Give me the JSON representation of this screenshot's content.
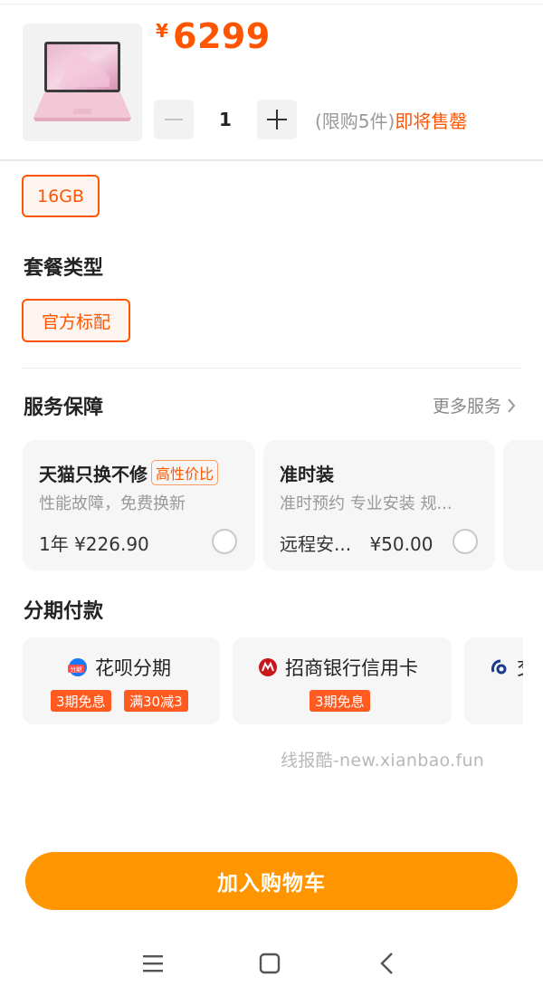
{
  "product": {
    "currency": "¥",
    "price": "6299",
    "quantity": "1",
    "limit_text": "(限购5件)",
    "limit_status": "即将售罄"
  },
  "specs": {
    "memory_option": "16GB",
    "package_title": "套餐类型",
    "package_option": "官方标配"
  },
  "services": {
    "title": "服务保障",
    "more_label": "更多服务",
    "cards": [
      {
        "title": "天猫只换不修",
        "tag": "高性价比",
        "subtitle": "性能故障，免费换新",
        "price_row": "1年 ¥226.90"
      },
      {
        "title": "准时装",
        "subtitle": "准时预约 专业安装 规...",
        "price_label": "远程安...",
        "price": "¥50.00"
      }
    ]
  },
  "installments": {
    "title": "分期付款",
    "options": [
      {
        "name": "花呗分期",
        "tags": [
          "3期免息",
          "满30减3"
        ]
      },
      {
        "name": "招商银行信用卡",
        "tags": [
          "3期免息"
        ]
      },
      {
        "name": "交"
      }
    ]
  },
  "watermark": "线报酷-new.xianbao.fun",
  "cart_button": "加入购物车",
  "colors": {
    "accent": "#ff5500",
    "cart_button": "#ff9500",
    "card_bg": "#f6f6f6"
  }
}
